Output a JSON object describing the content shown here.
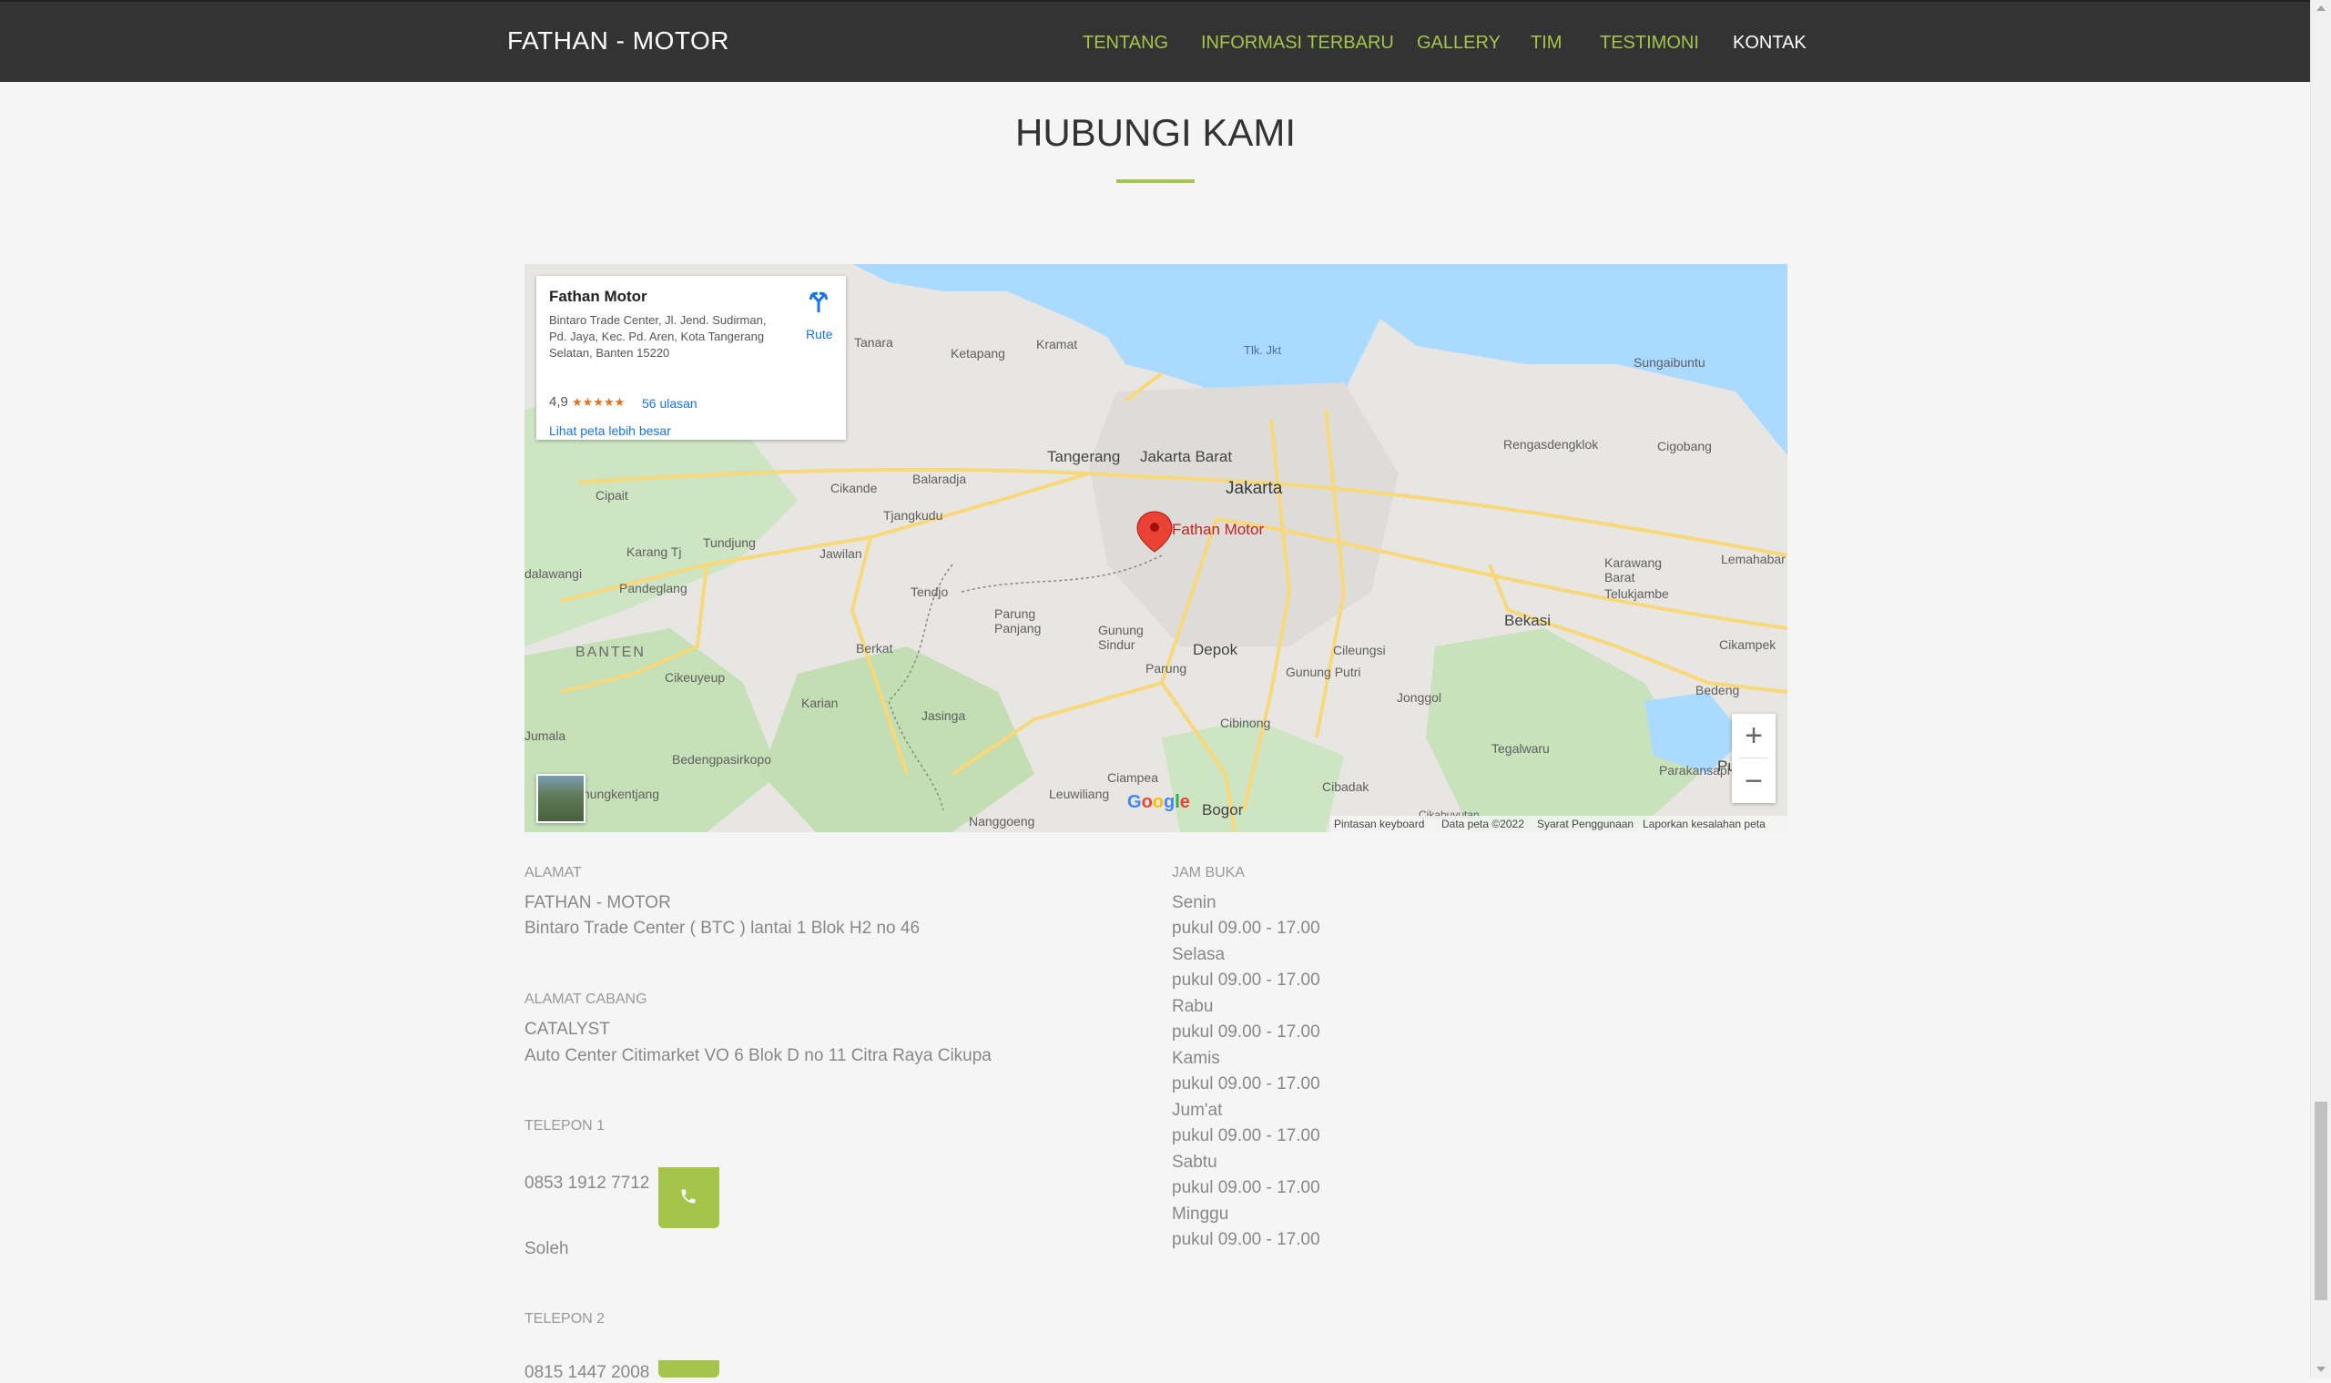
{
  "navbar": {
    "brand": "FATHAN - MOTOR",
    "items": [
      {
        "label": "TENTANG",
        "active": false
      },
      {
        "label": "INFORMASI TERBARU",
        "active": false
      },
      {
        "label": "GALLERY",
        "active": false
      },
      {
        "label": "TIM",
        "active": false
      },
      {
        "label": "TESTIMONI",
        "active": false
      },
      {
        "label": "KONTAK",
        "active": true
      }
    ]
  },
  "section": {
    "title": "HUBUNGI KAMI"
  },
  "map": {
    "card": {
      "name": "Fathan Motor",
      "address": "Bintaro Trade Center, Jl. Jend. Sudirman, Pd. Jaya, Kec. Pd. Aren, Kota Tangerang Selatan, Banten 15220",
      "rating": "4,9",
      "stars": "★★★★★",
      "reviews": "56 ulasan",
      "view_larger": "Lihat peta lebih besar",
      "route": "Rute"
    },
    "pin_label": "Fathan Motor",
    "places": {
      "tanara": "Tanara",
      "ketapang": "Ketapang",
      "kramat": "Kramat",
      "tlk_jkt": "Tlk. Jkt",
      "sungaibuntu": "Sungaibuntu",
      "rengasdengklok": "Rengasdengklok",
      "cigobang": "Cigobang",
      "tangerang": "Tangerang",
      "jakarta_barat": "Jakarta Barat",
      "jakarta": "Jakarta",
      "cipait": "Cipait",
      "cikande": "Cikande",
      "balaradja": "Balaradja",
      "tjangkudu": "Tjangkudu",
      "karang_tj": "Karang Tj",
      "tundjung": "Tundjung",
      "jawilan": "Jawilan",
      "dalawangi": "dalawangi",
      "pandeglang": "Pandeglang",
      "tendjo": "Tendjo",
      "parung_panjang": "Parung\nPanjang",
      "gunung_sindur": "Gunung\nSindur",
      "karawang_barat": "Karawang\nBarat",
      "lemahabang": "Lemahabar",
      "telukjambe": "Telukjambe",
      "bekasi": "Bekasi",
      "banten": "BANTEN",
      "berkat": "Berkat",
      "depok": "Depok",
      "cileungsi": "Cileungsi",
      "cikampek": "Cikampek",
      "cikeuyeup": "Cikeuyeup",
      "parung": "Parung",
      "gunung_putri": "Gunung Putri",
      "bedeng": "Bedeng",
      "karian": "Karian",
      "jonggol": "Jonggol",
      "jumala": "Jumala",
      "jasinga": "Jasinga",
      "cibinong": "Cibinong",
      "bedengpasirkopo": "Bedengpasirkopo",
      "tegalwaru": "Tegalwaru",
      "parakansapi": "Parakansapi",
      "purwakarta": "Pu",
      "nungkentjang": "nungkentjang",
      "ciampea": "Ciampea",
      "leuwiliang": "Leuwiliang",
      "cibadak": "Cibadak",
      "nanggoeng": "Nanggoeng",
      "bogor": "Bogor",
      "cikabuyutan": "Cikabuyutan"
    },
    "zoom_in": "+",
    "zoom_out": "−",
    "attribution": {
      "keyboard": "Pintasan keyboard",
      "data": "Data peta ©2022",
      "terms": "Syarat Penggunaan",
      "report": "Laporkan kesalahan peta"
    },
    "google": [
      "G",
      "o",
      "o",
      "g",
      "l",
      "e"
    ]
  },
  "contact": {
    "address_label": "ALAMAT",
    "address_name": "FATHAN - MOTOR",
    "address_line": "Bintaro Trade Center ( BTC ) lantai 1 Blok H2 no 46",
    "branch_label": "ALAMAT CABANG",
    "branch_name": "CATALYST",
    "branch_line": "Auto Center Citimarket VO 6 Blok D no 11 Citra Raya Cikupa",
    "phone1_label": "TELEPON 1",
    "phone1_number": "0853 1912 7712",
    "phone1_name": "Soleh",
    "phone2_label": "TELEPON 2",
    "phone2_number": "0815 1447 2008"
  },
  "hours": {
    "label": "JAM BUKA",
    "days": [
      {
        "day": "Senin",
        "time": "pukul 09.00 - 17.00"
      },
      {
        "day": "Selasa",
        "time": "pukul 09.00 - 17.00"
      },
      {
        "day": "Rabu",
        "time": "pukul 09.00 - 17.00"
      },
      {
        "day": "Kamis",
        "time": "pukul 09.00 - 17.00"
      },
      {
        "day": "Jum'at",
        "time": "pukul 09.00 - 17.00"
      },
      {
        "day": "Sabtu",
        "time": "pukul 09.00 - 17.00"
      },
      {
        "day": "Minggu",
        "time": "pukul 09.00 - 17.00"
      }
    ]
  },
  "colors": {
    "accent": "#a5c44a",
    "navbar": "#333333",
    "background": "#f5f5f5"
  }
}
